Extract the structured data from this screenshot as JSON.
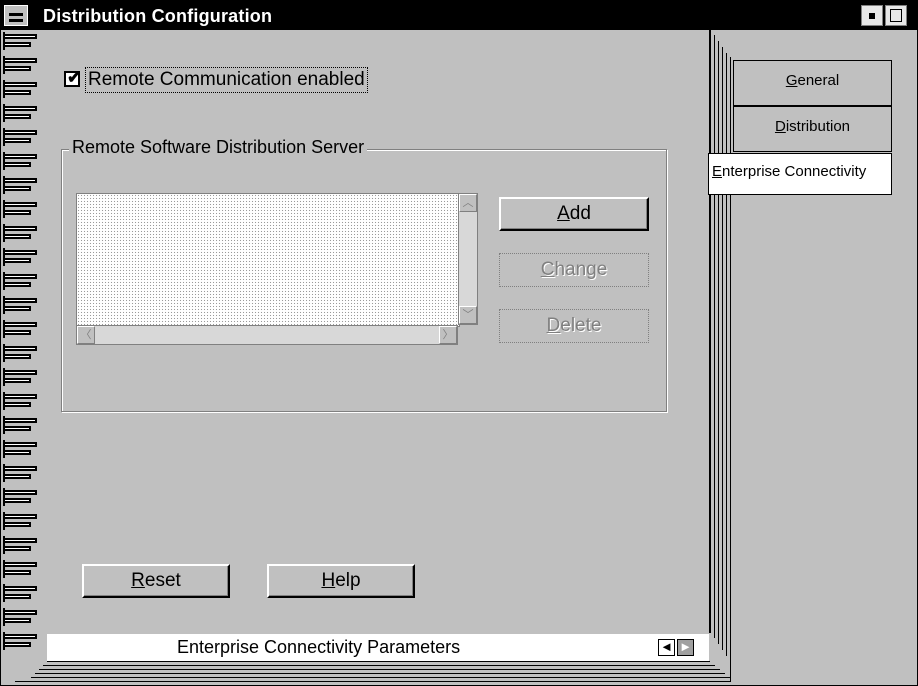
{
  "window": {
    "title": "Distribution Configuration",
    "system_menu_icon": "system-menu-icon",
    "minimize_icon": "minimize-icon",
    "maximize_icon": "maximize-icon"
  },
  "page": {
    "remote_comm_checkbox": {
      "label": "Remote Communication enabled",
      "checked": true,
      "check_glyph": "✔"
    },
    "server_group": {
      "title": "Remote Software Distribution Server",
      "list_items": [],
      "scroll_up": "︿",
      "scroll_down": "﹀",
      "scroll_left": "〈",
      "scroll_right": "〉"
    },
    "buttons": {
      "add": {
        "label": "Add",
        "mnemonic": "A",
        "rest": "dd",
        "enabled": true
      },
      "change": {
        "label": "Change",
        "mnemonic": "C",
        "rest": "hange",
        "enabled": false
      },
      "delete": {
        "label": "Delete",
        "mnemonic": "D",
        "rest": "elete",
        "enabled": false
      },
      "reset": {
        "label": "Reset",
        "mnemonic": "R",
        "rest": "eset",
        "enabled": true
      },
      "help": {
        "label": "Help",
        "mnemonic": "H",
        "rest": "elp",
        "enabled": true
      }
    },
    "status": {
      "text": "Enterprise Connectivity Parameters",
      "prev_glyph": "◄",
      "next_glyph": "►"
    }
  },
  "tabs": [
    {
      "label": "General",
      "mnemonic": "G",
      "rest": "eneral",
      "active": false
    },
    {
      "label": "Distribution",
      "mnemonic": "D",
      "rest": "istribution",
      "active": false
    },
    {
      "label": "Enterprise Connectivity",
      "mnemonic": "E",
      "rest": "nterprise Connectivity",
      "active": true
    }
  ],
  "colors": {
    "face": "#c0c0c0",
    "titlebar": "#000000",
    "disabled_text": "#808080"
  }
}
